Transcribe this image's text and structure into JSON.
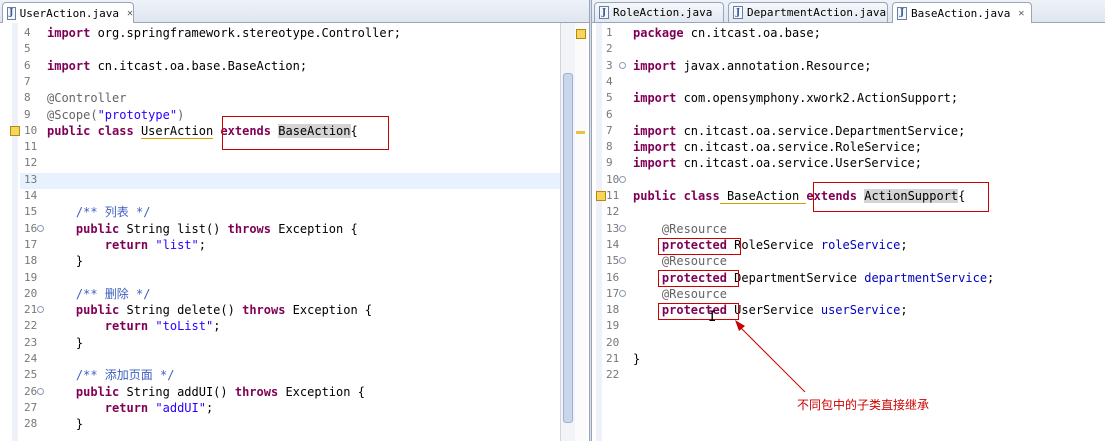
{
  "left_editor": {
    "tab_label": "UserAction.java",
    "lines": [
      {
        "n": "4",
        "tokens": [
          {
            "t": "import",
            "c": "kw"
          },
          {
            "t": " org.springframework.stereotype.Controller;",
            "c": "plain"
          }
        ]
      },
      {
        "n": "5",
        "tokens": []
      },
      {
        "n": "6",
        "tokens": [
          {
            "t": "import",
            "c": "kw"
          },
          {
            "t": " cn.itcast.oa.base.BaseAction;",
            "c": "plain"
          }
        ]
      },
      {
        "n": "7",
        "tokens": []
      },
      {
        "n": "8",
        "tokens": [
          {
            "t": "@Controller",
            "c": "ann"
          }
        ]
      },
      {
        "n": "9",
        "tokens": [
          {
            "t": "@Scope(",
            "c": "ann"
          },
          {
            "t": "\"prototype\"",
            "c": "str"
          },
          {
            "t": ")",
            "c": "ann"
          }
        ]
      },
      {
        "n": "10",
        "tokens": [
          {
            "t": "public",
            "c": "kw"
          },
          {
            "t": " ",
            "c": "plain"
          },
          {
            "t": "class",
            "c": "kw"
          },
          {
            "t": " ",
            "c": "plain"
          },
          {
            "t": "UserAction",
            "c": "plain underline"
          },
          {
            "t": " ",
            "c": "plain"
          },
          {
            "t": "extends",
            "c": "kw"
          },
          {
            "t": " ",
            "c": "plain"
          },
          {
            "t": "BaseAction",
            "c": "plain hl-sel"
          },
          {
            "t": "{",
            "c": "plain"
          }
        ]
      },
      {
        "n": "11",
        "tokens": []
      },
      {
        "n": "12",
        "tokens": []
      },
      {
        "n": "13",
        "tokens": []
      },
      {
        "n": "14",
        "tokens": []
      },
      {
        "n": "15",
        "tokens": [
          {
            "t": "    ",
            "c": "plain"
          },
          {
            "t": "/** 列表 */",
            "c": "cmt"
          }
        ]
      },
      {
        "n": "16",
        "tokens": [
          {
            "t": "    ",
            "c": "plain"
          },
          {
            "t": "public",
            "c": "kw"
          },
          {
            "t": " String list() ",
            "c": "plain"
          },
          {
            "t": "throws",
            "c": "kw"
          },
          {
            "t": " Exception {",
            "c": "plain"
          }
        ]
      },
      {
        "n": "17",
        "tokens": [
          {
            "t": "        ",
            "c": "plain"
          },
          {
            "t": "return",
            "c": "kw"
          },
          {
            "t": " ",
            "c": "plain"
          },
          {
            "t": "\"list\"",
            "c": "str"
          },
          {
            "t": ";",
            "c": "plain"
          }
        ]
      },
      {
        "n": "18",
        "tokens": [
          {
            "t": "    }",
            "c": "plain"
          }
        ]
      },
      {
        "n": "19",
        "tokens": []
      },
      {
        "n": "20",
        "tokens": [
          {
            "t": "    ",
            "c": "plain"
          },
          {
            "t": "/** 删除 */",
            "c": "cmt"
          }
        ]
      },
      {
        "n": "21",
        "tokens": [
          {
            "t": "    ",
            "c": "plain"
          },
          {
            "t": "public",
            "c": "kw"
          },
          {
            "t": " String delete() ",
            "c": "plain"
          },
          {
            "t": "throws",
            "c": "kw"
          },
          {
            "t": " Exception {",
            "c": "plain"
          }
        ]
      },
      {
        "n": "22",
        "tokens": [
          {
            "t": "        ",
            "c": "plain"
          },
          {
            "t": "return",
            "c": "kw"
          },
          {
            "t": " ",
            "c": "plain"
          },
          {
            "t": "\"toList\"",
            "c": "str"
          },
          {
            "t": ";",
            "c": "plain"
          }
        ]
      },
      {
        "n": "23",
        "tokens": [
          {
            "t": "    }",
            "c": "plain"
          }
        ]
      },
      {
        "n": "24",
        "tokens": []
      },
      {
        "n": "25",
        "tokens": [
          {
            "t": "    ",
            "c": "plain"
          },
          {
            "t": "/** 添加页面 */",
            "c": "cmt"
          }
        ]
      },
      {
        "n": "26",
        "tokens": [
          {
            "t": "    ",
            "c": "plain"
          },
          {
            "t": "public",
            "c": "kw"
          },
          {
            "t": " String addUI() ",
            "c": "plain"
          },
          {
            "t": "throws",
            "c": "kw"
          },
          {
            "t": " Exception {",
            "c": "plain"
          }
        ]
      },
      {
        "n": "27",
        "tokens": [
          {
            "t": "        ",
            "c": "plain"
          },
          {
            "t": "return",
            "c": "kw"
          },
          {
            "t": " ",
            "c": "plain"
          },
          {
            "t": "\"addUI\"",
            "c": "str"
          },
          {
            "t": ";",
            "c": "plain"
          }
        ]
      },
      {
        "n": "28",
        "tokens": [
          {
            "t": "    }",
            "c": "plain"
          }
        ]
      }
    ]
  },
  "right_editor": {
    "tabs": [
      {
        "label": "RoleAction.java"
      },
      {
        "label": "DepartmentAction.java"
      },
      {
        "label": "BaseAction.java"
      }
    ],
    "lines": [
      {
        "n": "1",
        "tokens": [
          {
            "t": "package",
            "c": "kw"
          },
          {
            "t": " cn.itcast.oa.base;",
            "c": "plain"
          }
        ]
      },
      {
        "n": "2",
        "tokens": []
      },
      {
        "n": "3",
        "tokens": [
          {
            "t": "import",
            "c": "kw"
          },
          {
            "t": " javax.annotation.Resource;",
            "c": "plain"
          }
        ]
      },
      {
        "n": "4",
        "tokens": []
      },
      {
        "n": "5",
        "tokens": [
          {
            "t": "import",
            "c": "kw"
          },
          {
            "t": " com.opensymphony.xwork2.ActionSupport;",
            "c": "plain"
          }
        ]
      },
      {
        "n": "6",
        "tokens": []
      },
      {
        "n": "7",
        "tokens": [
          {
            "t": "import",
            "c": "kw"
          },
          {
            "t": " cn.itcast.oa.service.DepartmentService;",
            "c": "plain"
          }
        ]
      },
      {
        "n": "8",
        "tokens": [
          {
            "t": "import",
            "c": "kw"
          },
          {
            "t": " cn.itcast.oa.service.RoleService;",
            "c": "plain"
          }
        ]
      },
      {
        "n": "9",
        "tokens": [
          {
            "t": "import",
            "c": "kw"
          },
          {
            "t": " cn.itcast.oa.service.UserService;",
            "c": "plain"
          }
        ]
      },
      {
        "n": "10",
        "tokens": []
      },
      {
        "n": "11",
        "tokens": [
          {
            "t": "public",
            "c": "kw"
          },
          {
            "t": " ",
            "c": "plain"
          },
          {
            "t": "class",
            "c": "kw"
          },
          {
            "t": " BaseAction ",
            "c": "plain underline"
          },
          {
            "t": "extends",
            "c": "kw"
          },
          {
            "t": " ",
            "c": "plain"
          },
          {
            "t": "ActionSupport",
            "c": "plain hl-sel"
          },
          {
            "t": "{",
            "c": "plain"
          }
        ]
      },
      {
        "n": "12",
        "tokens": []
      },
      {
        "n": "13",
        "tokens": [
          {
            "t": "    ",
            "c": "plain"
          },
          {
            "t": "@Resource",
            "c": "ann"
          }
        ]
      },
      {
        "n": "14",
        "tokens": [
          {
            "t": "    ",
            "c": "plain"
          },
          {
            "t": "protected",
            "c": "kw"
          },
          {
            "t": " RoleService ",
            "c": "plain"
          },
          {
            "t": "roleService",
            "c": "fld"
          },
          {
            "t": ";",
            "c": "plain"
          }
        ]
      },
      {
        "n": "15",
        "tokens": [
          {
            "t": "    ",
            "c": "plain"
          },
          {
            "t": "@Resource",
            "c": "ann"
          }
        ]
      },
      {
        "n": "16",
        "tokens": [
          {
            "t": "    ",
            "c": "plain"
          },
          {
            "t": "protected",
            "c": "kw"
          },
          {
            "t": " DepartmentService ",
            "c": "plain"
          },
          {
            "t": "departmentService",
            "c": "fld"
          },
          {
            "t": ";",
            "c": "plain"
          }
        ]
      },
      {
        "n": "17",
        "tokens": [
          {
            "t": "    ",
            "c": "plain"
          },
          {
            "t": "@Resource",
            "c": "ann"
          }
        ]
      },
      {
        "n": "18",
        "tokens": [
          {
            "t": "    ",
            "c": "plain"
          },
          {
            "t": "protected",
            "c": "kw"
          },
          {
            "t": " UserService ",
            "c": "plain"
          },
          {
            "t": "userService",
            "c": "fld"
          },
          {
            "t": ";",
            "c": "plain"
          }
        ]
      },
      {
        "n": "19",
        "tokens": []
      },
      {
        "n": "20",
        "tokens": []
      },
      {
        "n": "21",
        "tokens": [
          {
            "t": "}",
            "c": "plain"
          }
        ]
      },
      {
        "n": "22",
        "tokens": []
      }
    ]
  },
  "annotation": {
    "label": "不同包中的子类直接继承",
    "color": "#cc0000"
  },
  "colors": {
    "keyword": "#7f0055",
    "string": "#2a00ff",
    "comment": "#3f5fbf",
    "annotation": "#646464",
    "field": "#0000c0",
    "highlight_box": "#cc0000"
  }
}
